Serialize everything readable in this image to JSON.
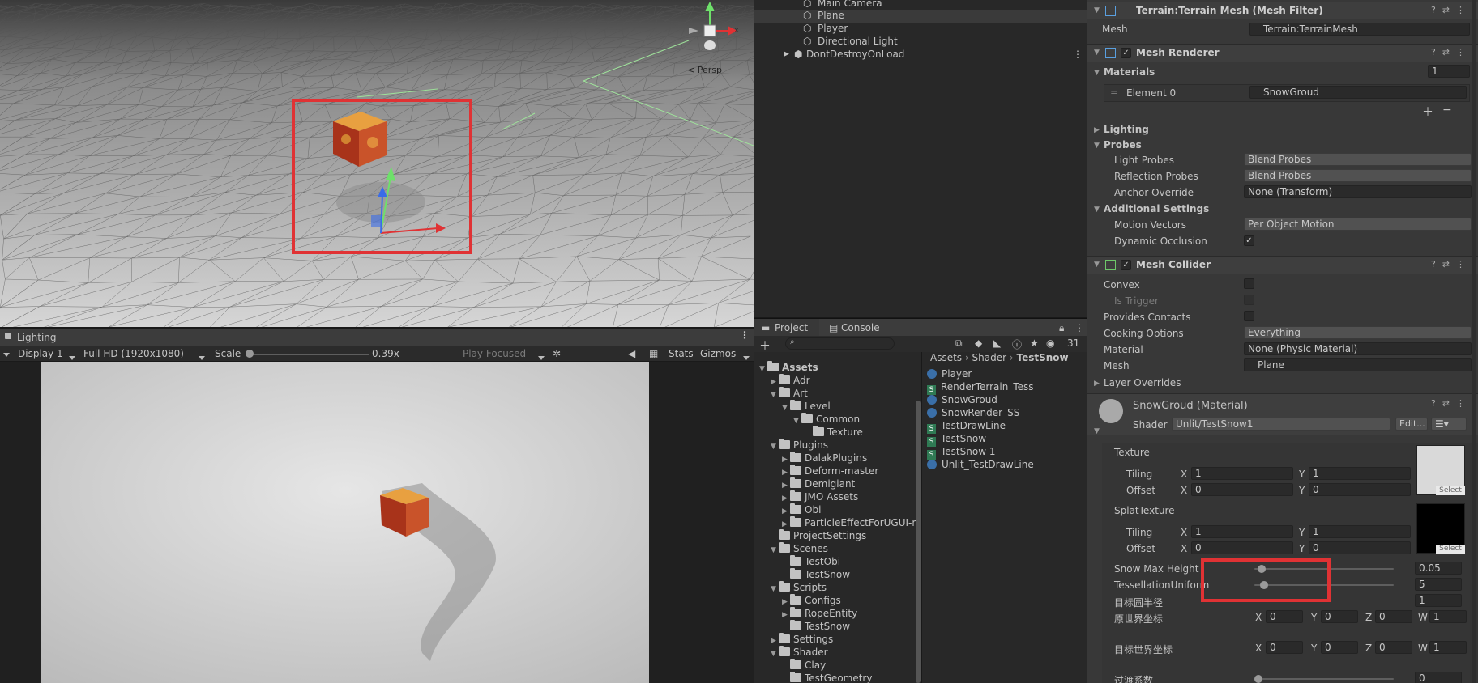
{
  "colors": {
    "accent_red": "#e03234",
    "panel": "#383838",
    "toolbar": "#3c3c3c"
  },
  "scene": {
    "persp_label": "< Persp"
  },
  "hierarchy": {
    "items": [
      "Main Camera",
      "Plane",
      "Player",
      "Directional Light",
      "DontDestroyOnLoad"
    ]
  },
  "game": {
    "tab_label": "Lighting",
    "display": "Display 1",
    "resolution": "Full HD (1920x1080)",
    "scale_label": "Scale",
    "scale_value": "0.39x",
    "play_focused": "Play Focused",
    "stats": "Stats",
    "gizmos": "Gizmos"
  },
  "project": {
    "tab_project": "Project",
    "tab_console": "Console",
    "badge_count": "31",
    "tree": [
      "Assets",
      "Adr",
      "Art",
      "Level",
      "Common",
      "Texture",
      "Plugins",
      "DalakPlugins",
      "Deform-master",
      "Demigiant",
      "JMO Assets",
      "Obi",
      "ParticleEffectForUGUI-m",
      "ProjectSettings",
      "Scenes",
      "TestObi",
      "TestSnow",
      "Scripts",
      "Configs",
      "RopeEntity",
      "TestSnow",
      "Settings",
      "Shader",
      "Clay",
      "TestGeometry"
    ],
    "breadcrumb": [
      "Assets",
      "Shader",
      "TestSnow"
    ],
    "files": [
      {
        "name": "Player",
        "kind": "shader"
      },
      {
        "name": "RenderTerrain_Tess",
        "kind": "script"
      },
      {
        "name": "SnowGroud",
        "kind": "shader"
      },
      {
        "name": "SnowRender_SS",
        "kind": "shader"
      },
      {
        "name": "TestDrawLine",
        "kind": "script"
      },
      {
        "name": "TestSnow",
        "kind": "script"
      },
      {
        "name": "TestSnow 1",
        "kind": "script"
      },
      {
        "name": "Unlit_TestDrawLine",
        "kind": "shader"
      }
    ]
  },
  "inspector": {
    "mesh_filter": {
      "title": "Terrain:Terrain Mesh (Mesh Filter)",
      "mesh_label": "Mesh",
      "mesh_value": "Terrain:TerrainMesh"
    },
    "mesh_renderer": {
      "title": "Mesh Renderer",
      "materials_label": "Materials",
      "materials_count": "1",
      "element0_label": "Element 0",
      "element0_value": "SnowGroud",
      "lighting": "Lighting",
      "probes": "Probes",
      "light_probes_label": "Light Probes",
      "light_probes_value": "Blend Probes",
      "reflection_probes_label": "Reflection Probes",
      "reflection_probes_value": "Blend Probes",
      "anchor_override_label": "Anchor Override",
      "anchor_override_value": "None (Transform)",
      "additional_settings": "Additional Settings",
      "motion_vectors_label": "Motion Vectors",
      "motion_vectors_value": "Per Object Motion",
      "dynamic_occlusion_label": "Dynamic Occlusion"
    },
    "mesh_collider": {
      "title": "Mesh Collider",
      "convex": "Convex",
      "is_trigger": "Is Trigger",
      "provides_contacts": "Provides Contacts",
      "cooking_options_label": "Cooking Options",
      "cooking_options_value": "Everything",
      "material_label": "Material",
      "material_value": "None (Physic Material)",
      "mesh_label": "Mesh",
      "mesh_value": "Plane",
      "layer_overrides": "Layer Overrides"
    },
    "material": {
      "title": "SnowGroud (Material)",
      "shader_label": "Shader",
      "shader_value": "Unlit/TestSnow1",
      "edit_button": "Edit...",
      "texture_label": "Texture",
      "tiling": "Tiling",
      "offset": "Offset",
      "x": "X",
      "y": "Y",
      "z": "Z",
      "w": "W",
      "select": "Select",
      "tex_tiling_x": "1",
      "tex_tiling_y": "1",
      "tex_offset_x": "0",
      "tex_offset_y": "0",
      "splat_label": "SplatTexture",
      "splat_tiling_x": "1",
      "splat_tiling_y": "1",
      "splat_offset_x": "0",
      "splat_offset_y": "0",
      "snow_max_height_label": "Snow Max Height",
      "snow_max_height_value": "0.05",
      "snow_max_height_level": 0.05,
      "tess_label": "TessellationUniform",
      "tess_value": "5",
      "tess_level": 0.07,
      "target_radius_label": "目标圆半径",
      "target_radius_value": "1",
      "orig_world_label": "原世界坐标",
      "orig_x": "0",
      "orig_y": "0",
      "orig_z": "0",
      "orig_w": "1",
      "target_world_label": "目标世界坐标",
      "tgt_x": "0",
      "tgt_y": "0",
      "tgt_z": "0",
      "tgt_w": "1",
      "transition_label": "过渡系数",
      "transition_value": "0"
    }
  }
}
